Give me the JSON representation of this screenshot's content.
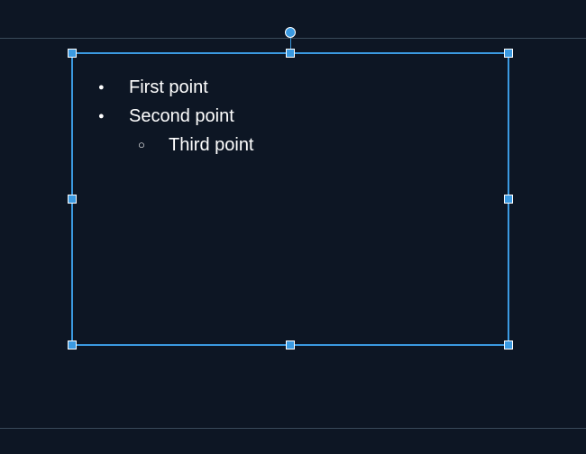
{
  "textbox": {
    "bullets": [
      {
        "level": 0,
        "style": "solid",
        "text": "First point"
      },
      {
        "level": 0,
        "style": "solid",
        "text": "Second point"
      },
      {
        "level": 1,
        "style": "open",
        "text": "Third point"
      }
    ]
  }
}
